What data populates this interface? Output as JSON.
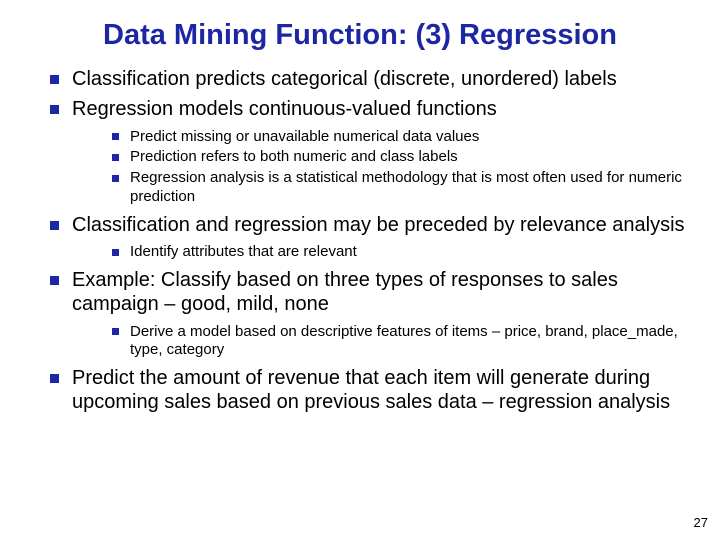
{
  "title": "Data Mining Function: (3) Regression",
  "bullets": [
    {
      "text": "Classification predicts categorical (discrete, unordered) labels",
      "sub": []
    },
    {
      "text": "Regression models continuous-valued functions",
      "sub": [
        {
          "text": "Predict missing or unavailable numerical data values"
        },
        {
          "text": "Prediction refers to both numeric and class labels"
        },
        {
          "text": "Regression analysis is a statistical methodology that is most often used for numeric prediction"
        }
      ]
    },
    {
      "text": "Classification and regression may be preceded by relevance analysis",
      "sub": [
        {
          "text": "Identify attributes that are relevant"
        }
      ]
    },
    {
      "text": "Example: Classify based on three types of responses to sales campaign – good, mild, none",
      "sub": [
        {
          "text": "Derive a model based on descriptive features of items – price, brand, place_made, type, category"
        }
      ]
    },
    {
      "text": "Predict the amount of revenue that each item will generate during upcoming sales based on previous sales data – regression analysis",
      "sub": []
    }
  ],
  "page_number": "27"
}
